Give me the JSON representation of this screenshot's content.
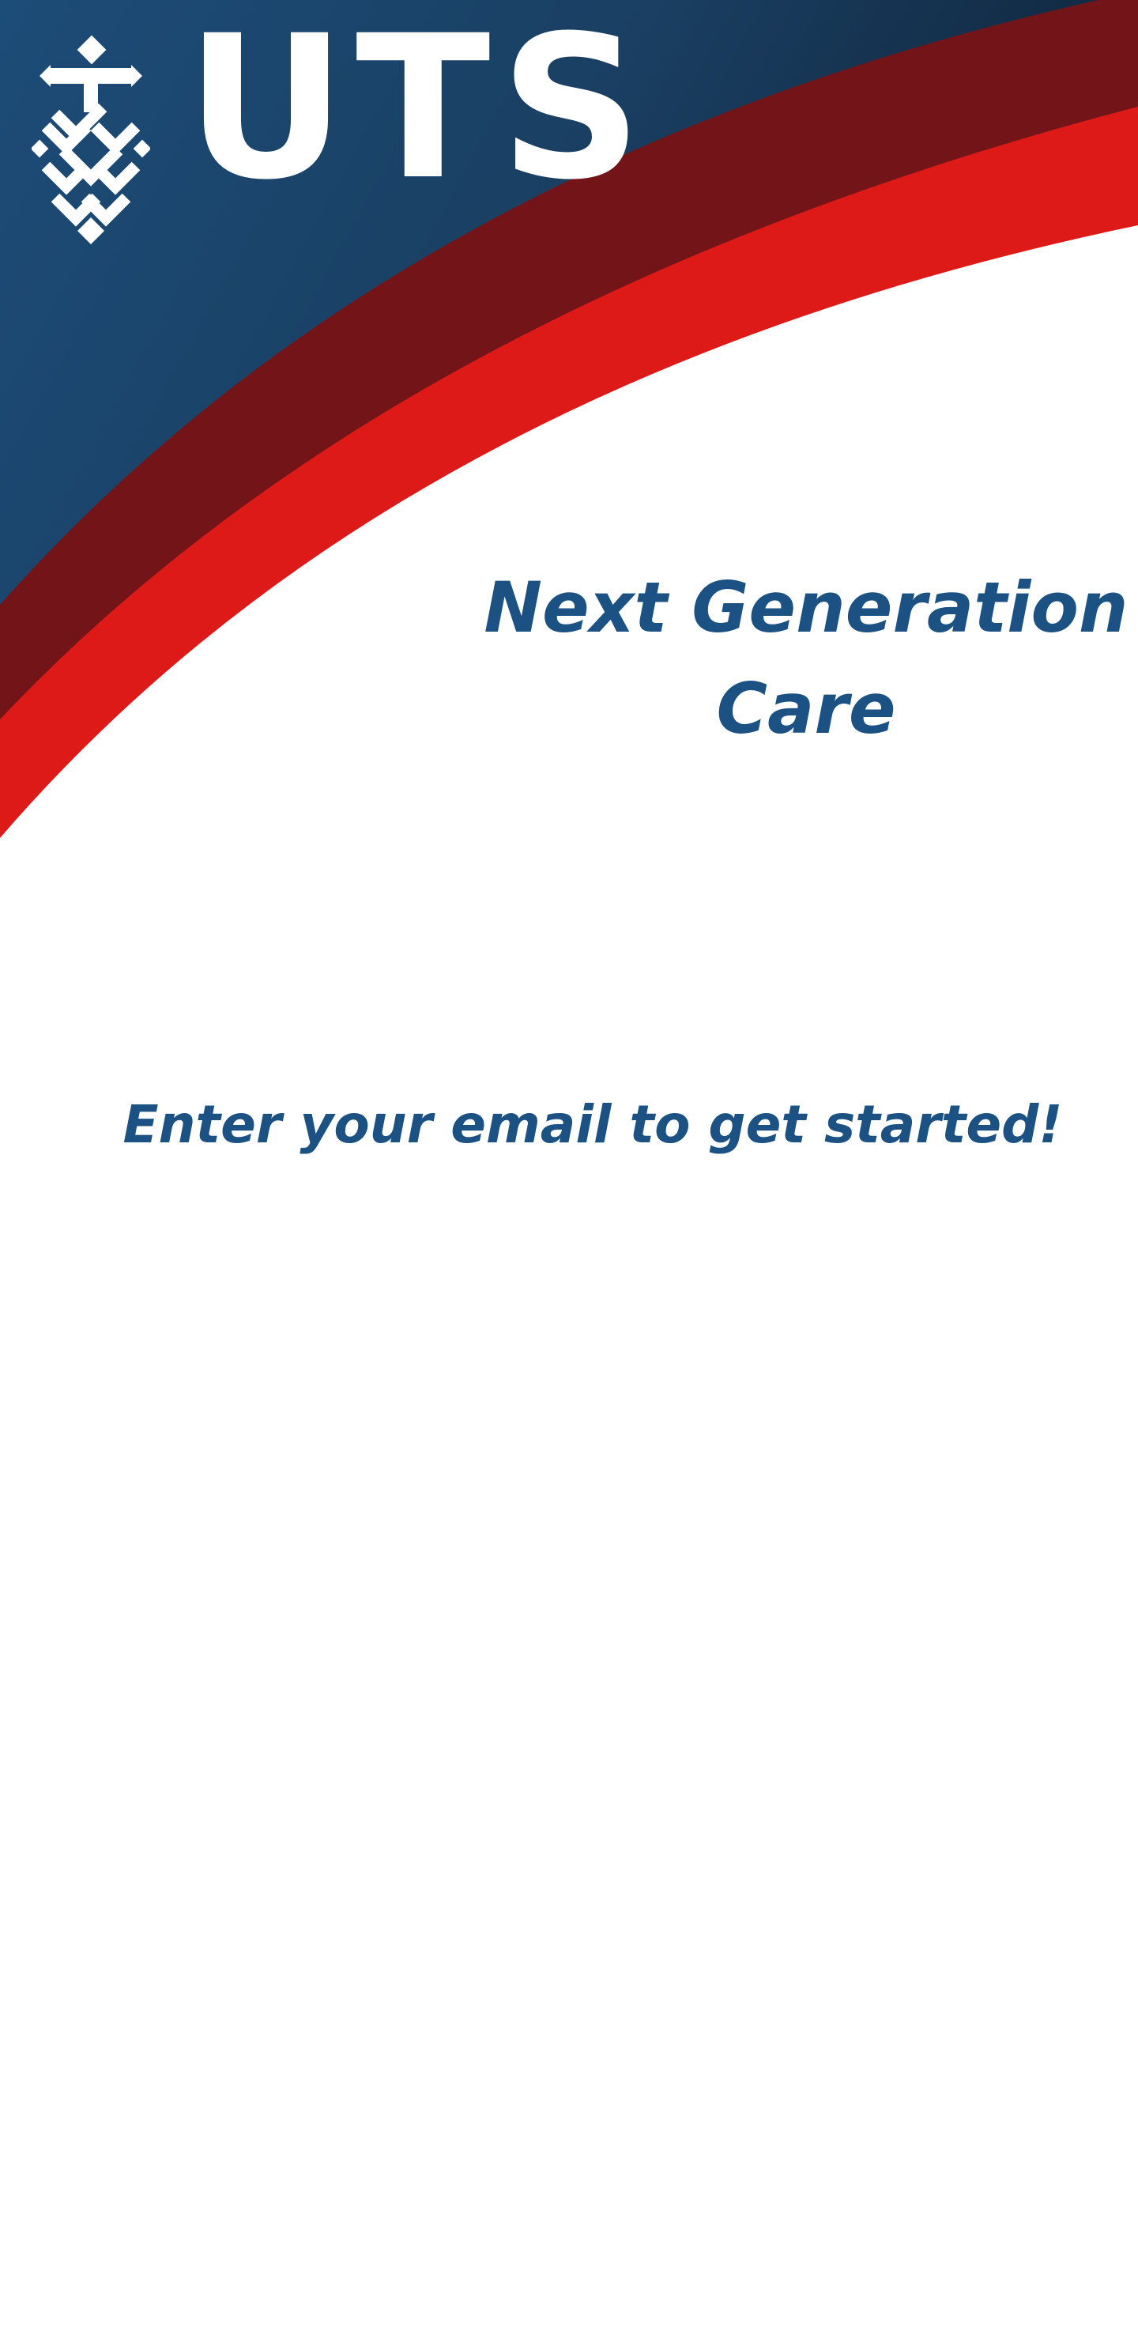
{
  "header": {
    "logo_text": "UTS",
    "logo_icon": "uts-crest-icon"
  },
  "main": {
    "title_line1": "Next Generation",
    "title_line2": "Care",
    "prompt": "Enter your email to get started!"
  },
  "colors": {
    "navy_dark": "#132f4d",
    "navy": "#1c4a72",
    "maroon": "#731518",
    "red": "#dd1a18",
    "text_blue": "#1c5183",
    "white": "#ffffff"
  }
}
